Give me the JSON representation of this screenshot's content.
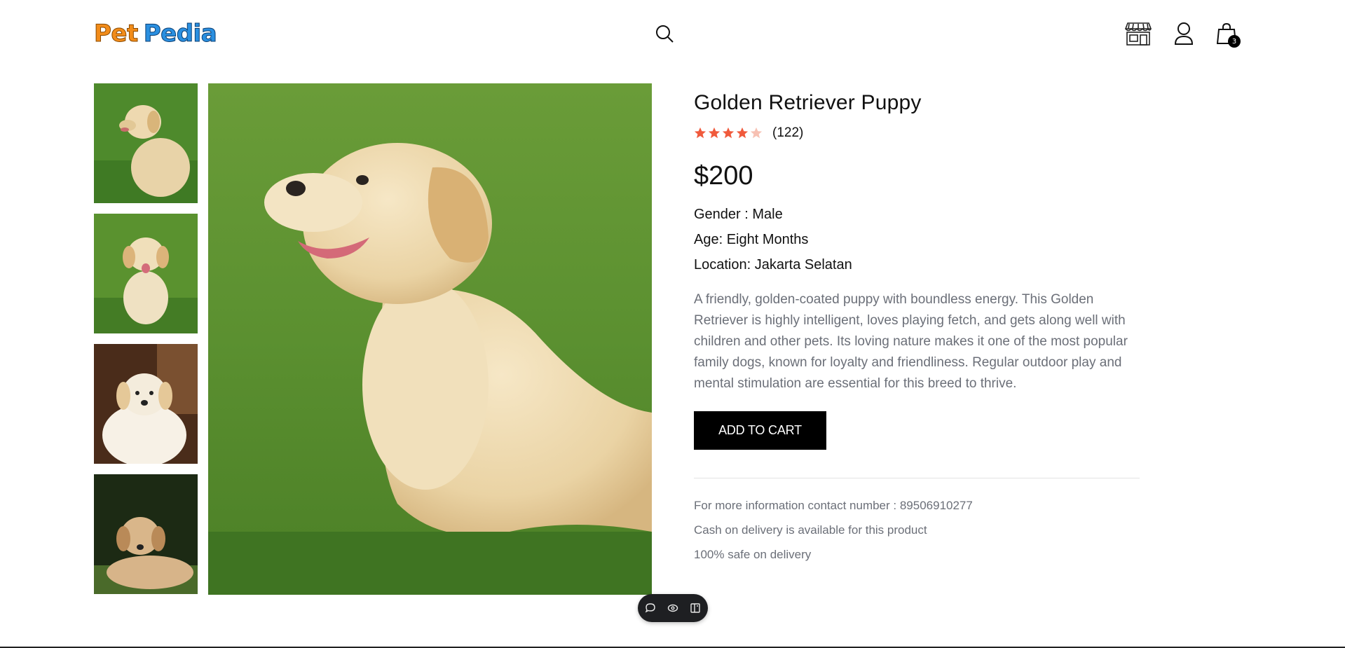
{
  "header": {
    "logo": {
      "part1": "Pet",
      "part2": "Pedia"
    },
    "icons": [
      "search-icon",
      "store-icon",
      "user-icon",
      "shopping-bag-icon"
    ],
    "cart_count": "3"
  },
  "gallery": {
    "thumbnails": [
      "thumbnail-1",
      "thumbnail-2",
      "thumbnail-3",
      "thumbnail-4"
    ]
  },
  "product": {
    "title": "Golden Retriever Puppy",
    "rating": 4,
    "rating_max": 5,
    "reviews": "(122)",
    "price": "$200",
    "gender": "Gender : Male",
    "age": "Age: Eight Months",
    "location": "Location: Jakarta Selatan",
    "description": "A friendly, golden-coated puppy with boundless energy. This Golden Retriever is highly intelligent, loves playing fetch, and gets along well with children and other pets. Its loving nature makes it one of the most popular family dogs, known for loyalty and friendliness. Regular outdoor play and mental stimulation are essential for this breed to thrive.",
    "add_to_cart": "ADD TO CART",
    "notes": [
      "For more information contact number : 89506910277",
      "Cash on delivery is available for this product",
      "100% safe on delivery"
    ]
  },
  "colors": {
    "star": "#f05a3c",
    "star_empty": "#f7c1b3",
    "muted_text": "#6b6f78",
    "button_bg": "#000000"
  }
}
